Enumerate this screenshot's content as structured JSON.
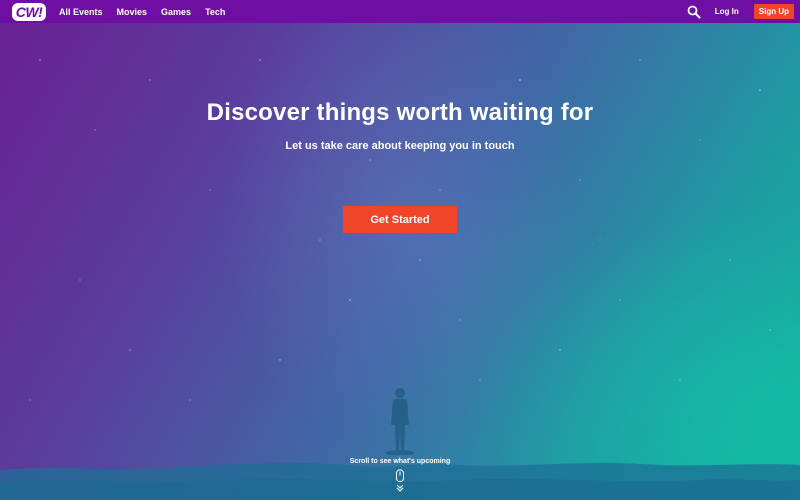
{
  "brand": {
    "logo_text": "CW!"
  },
  "nav": {
    "items": [
      {
        "label": "All Events"
      },
      {
        "label": "Movies"
      },
      {
        "label": "Games"
      },
      {
        "label": "Tech"
      }
    ],
    "login_label": "Log In",
    "signup_label": "Sign Up"
  },
  "hero": {
    "title": "Discover things worth waiting for",
    "subtitle": "Let us take care about keeping you in touch",
    "cta_label": "Get Started",
    "scroll_hint": "Scroll to see what's upcoming"
  },
  "colors": {
    "nav_bg": "#6f0ea3",
    "accent": "#f1452a"
  },
  "icons": {
    "search": "search-icon",
    "scroll": "mouse-icon",
    "down": "chevron-down-icon"
  }
}
